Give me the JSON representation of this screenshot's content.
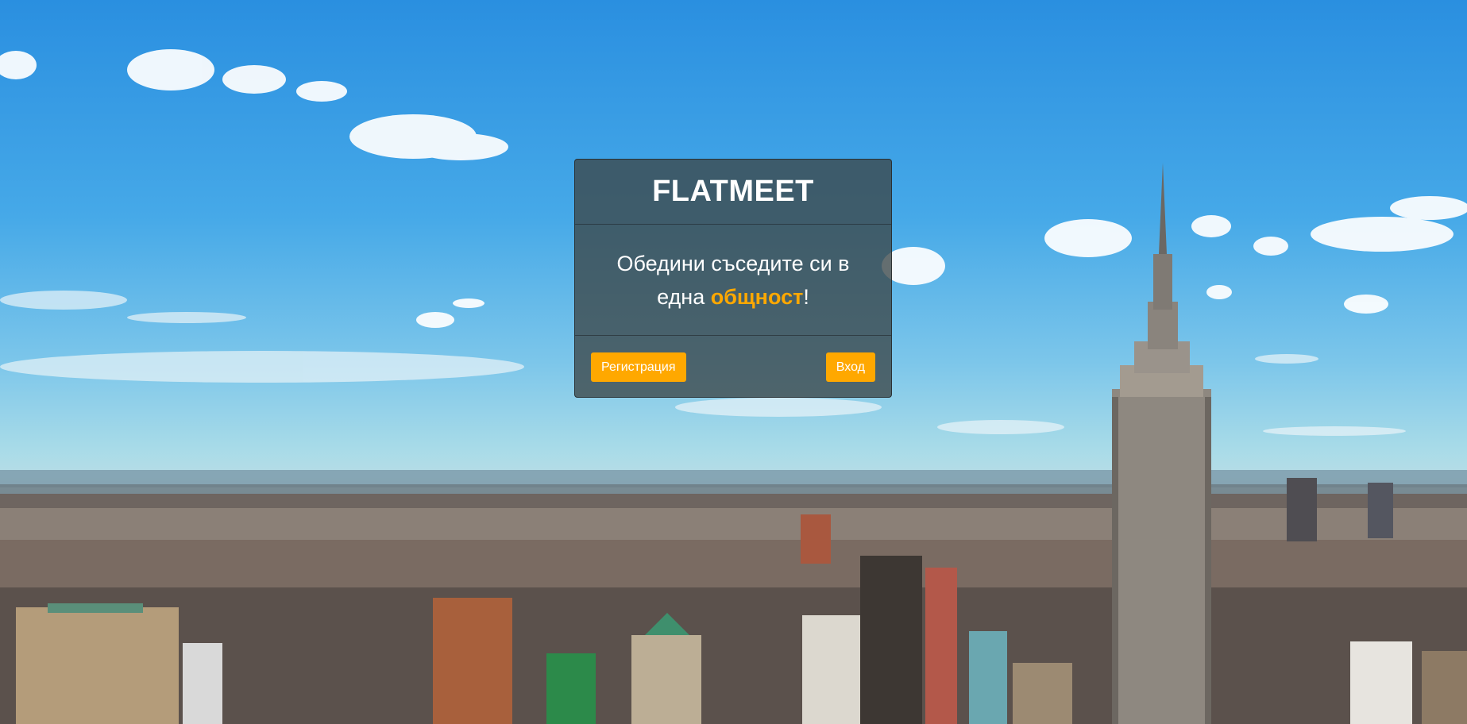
{
  "brand": {
    "title": "FLATMEET"
  },
  "hero": {
    "tagline_before": "Обедини съседите си в една ",
    "tagline_highlight": "общност",
    "tagline_after": "!"
  },
  "actions": {
    "register_label": "Регистрация",
    "login_label": "Вход"
  },
  "colors": {
    "accent": "#ffa800",
    "card_bg": "rgba(60, 70, 72, 0.78)",
    "text": "#ffffff"
  },
  "background": {
    "icon": "city-skyline-photo"
  }
}
